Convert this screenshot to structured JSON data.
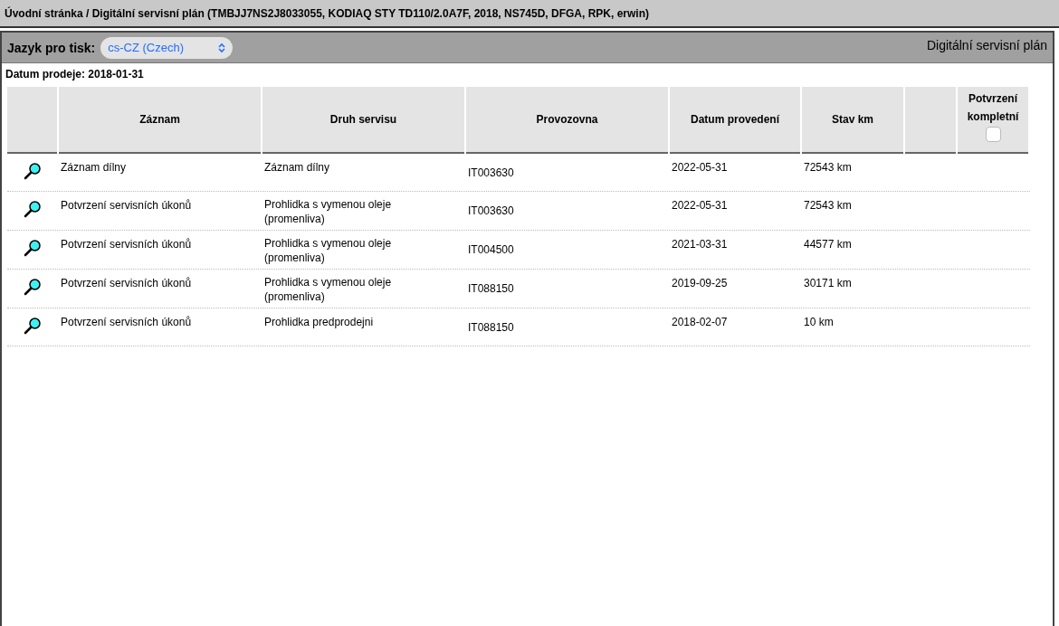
{
  "title_bar": "Úvodní stránka / Digitální servisní plán (TMBJJ7NS2J8033055, KODIAQ STY TD110/2.0A7F, 2018, NS745D, DFGA, RPK, erwin)",
  "toolbar": {
    "language_label": "Jazyk pro tisk:",
    "language_value": "cs-CZ (Czech)",
    "panel_title": "Digitální servisní plán"
  },
  "sale_date": "Datum prodeje: 2018-01-31",
  "table": {
    "columns": [
      "Záznam",
      "Druh servisu",
      "Provozovna",
      "Datum provedení",
      "Stav km"
    ],
    "confirm_column": {
      "label": "Potvrzení kompletní",
      "checked": false
    },
    "rows": [
      {
        "record": "Záznam dílny",
        "service": "Záznam dílny",
        "workshop": "IT003630",
        "date": "2022-05-31",
        "km": "72543 km"
      },
      {
        "record": "Potvrzení servisních úkonů",
        "service": "Prohlidka s vymenou oleje\n(promenliva)",
        "workshop": "IT003630",
        "date": "2022-05-31",
        "km": "72543 km"
      },
      {
        "record": "Potvrzení servisních úkonů",
        "service": "Prohlidka s vymenou oleje\n(promenliva)",
        "workshop": "IT004500",
        "date": "2021-03-31",
        "km": "44577 km"
      },
      {
        "record": "Potvrzení servisních úkonů",
        "service": "Prohlidka s vymenou oleje\n(promenliva)",
        "workshop": "IT088150",
        "date": "2019-09-25",
        "km": "30171 km"
      },
      {
        "record": "Potvrzení servisních úkonů",
        "service": "Prohlidka predprodejni",
        "workshop": "IT088150",
        "date": "2018-02-07",
        "km": "10 km"
      }
    ]
  }
}
